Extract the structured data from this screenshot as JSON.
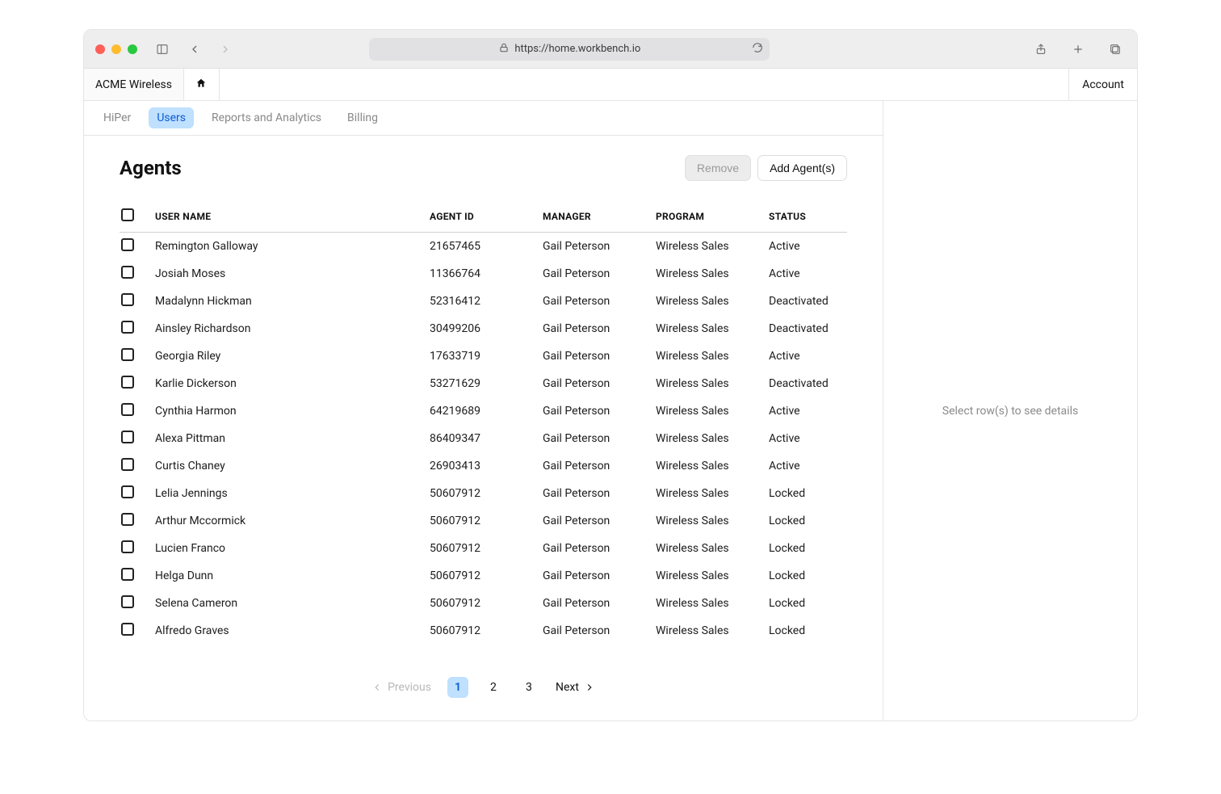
{
  "browser": {
    "url": "https://home.workbench.io"
  },
  "header": {
    "company": "ACME Wireless",
    "account": "Account"
  },
  "subnav": {
    "items": [
      {
        "label": "HiPer",
        "active": false
      },
      {
        "label": "Users",
        "active": true
      },
      {
        "label": "Reports and Analytics",
        "active": false
      },
      {
        "label": "Billing",
        "active": false
      }
    ]
  },
  "page": {
    "title": "Agents",
    "remove_label": "Remove",
    "add_label": "Add Agent(s)"
  },
  "table": {
    "columns": {
      "name": "USER NAME",
      "agent_id": "AGENT ID",
      "manager": "MANAGER",
      "program": "PROGRAM",
      "status": "STATUS"
    },
    "rows": [
      {
        "name": "Remington Galloway",
        "agent_id": "21657465",
        "manager": "Gail Peterson",
        "program": "Wireless Sales",
        "status": "Active"
      },
      {
        "name": "Josiah Moses",
        "agent_id": "11366764",
        "manager": "Gail Peterson",
        "program": "Wireless Sales",
        "status": "Active"
      },
      {
        "name": "Madalynn Hickman",
        "agent_id": "52316412",
        "manager": "Gail Peterson",
        "program": "Wireless Sales",
        "status": "Deactivated"
      },
      {
        "name": "Ainsley Richardson",
        "agent_id": "30499206",
        "manager": "Gail Peterson",
        "program": "Wireless Sales",
        "status": "Deactivated"
      },
      {
        "name": "Georgia Riley",
        "agent_id": "17633719",
        "manager": "Gail Peterson",
        "program": "Wireless Sales",
        "status": "Active"
      },
      {
        "name": "Karlie Dickerson",
        "agent_id": "53271629",
        "manager": "Gail Peterson",
        "program": "Wireless Sales",
        "status": "Deactivated"
      },
      {
        "name": "Cynthia Harmon",
        "agent_id": "64219689",
        "manager": "Gail Peterson",
        "program": "Wireless Sales",
        "status": "Active"
      },
      {
        "name": "Alexa Pittman",
        "agent_id": "86409347",
        "manager": "Gail Peterson",
        "program": "Wireless Sales",
        "status": "Active"
      },
      {
        "name": "Curtis Chaney",
        "agent_id": "26903413",
        "manager": "Gail Peterson",
        "program": "Wireless Sales",
        "status": "Active"
      },
      {
        "name": "Lelia Jennings",
        "agent_id": "50607912",
        "manager": "Gail Peterson",
        "program": "Wireless Sales",
        "status": "Locked"
      },
      {
        "name": "Arthur Mccormick",
        "agent_id": "50607912",
        "manager": "Gail Peterson",
        "program": "Wireless Sales",
        "status": "Locked"
      },
      {
        "name": "Lucien Franco",
        "agent_id": "50607912",
        "manager": "Gail Peterson",
        "program": "Wireless Sales",
        "status": "Locked"
      },
      {
        "name": "Helga Dunn",
        "agent_id": "50607912",
        "manager": "Gail Peterson",
        "program": "Wireless Sales",
        "status": "Locked"
      },
      {
        "name": "Selena Cameron",
        "agent_id": "50607912",
        "manager": "Gail Peterson",
        "program": "Wireless Sales",
        "status": "Locked"
      },
      {
        "name": "Alfredo Graves",
        "agent_id": "50607912",
        "manager": "Gail Peterson",
        "program": "Wireless Sales",
        "status": "Locked"
      }
    ]
  },
  "pagination": {
    "prev_label": "Previous",
    "next_label": "Next",
    "pages": [
      "1",
      "2",
      "3"
    ],
    "active": "1"
  },
  "side": {
    "empty": "Select row(s) to see details"
  }
}
